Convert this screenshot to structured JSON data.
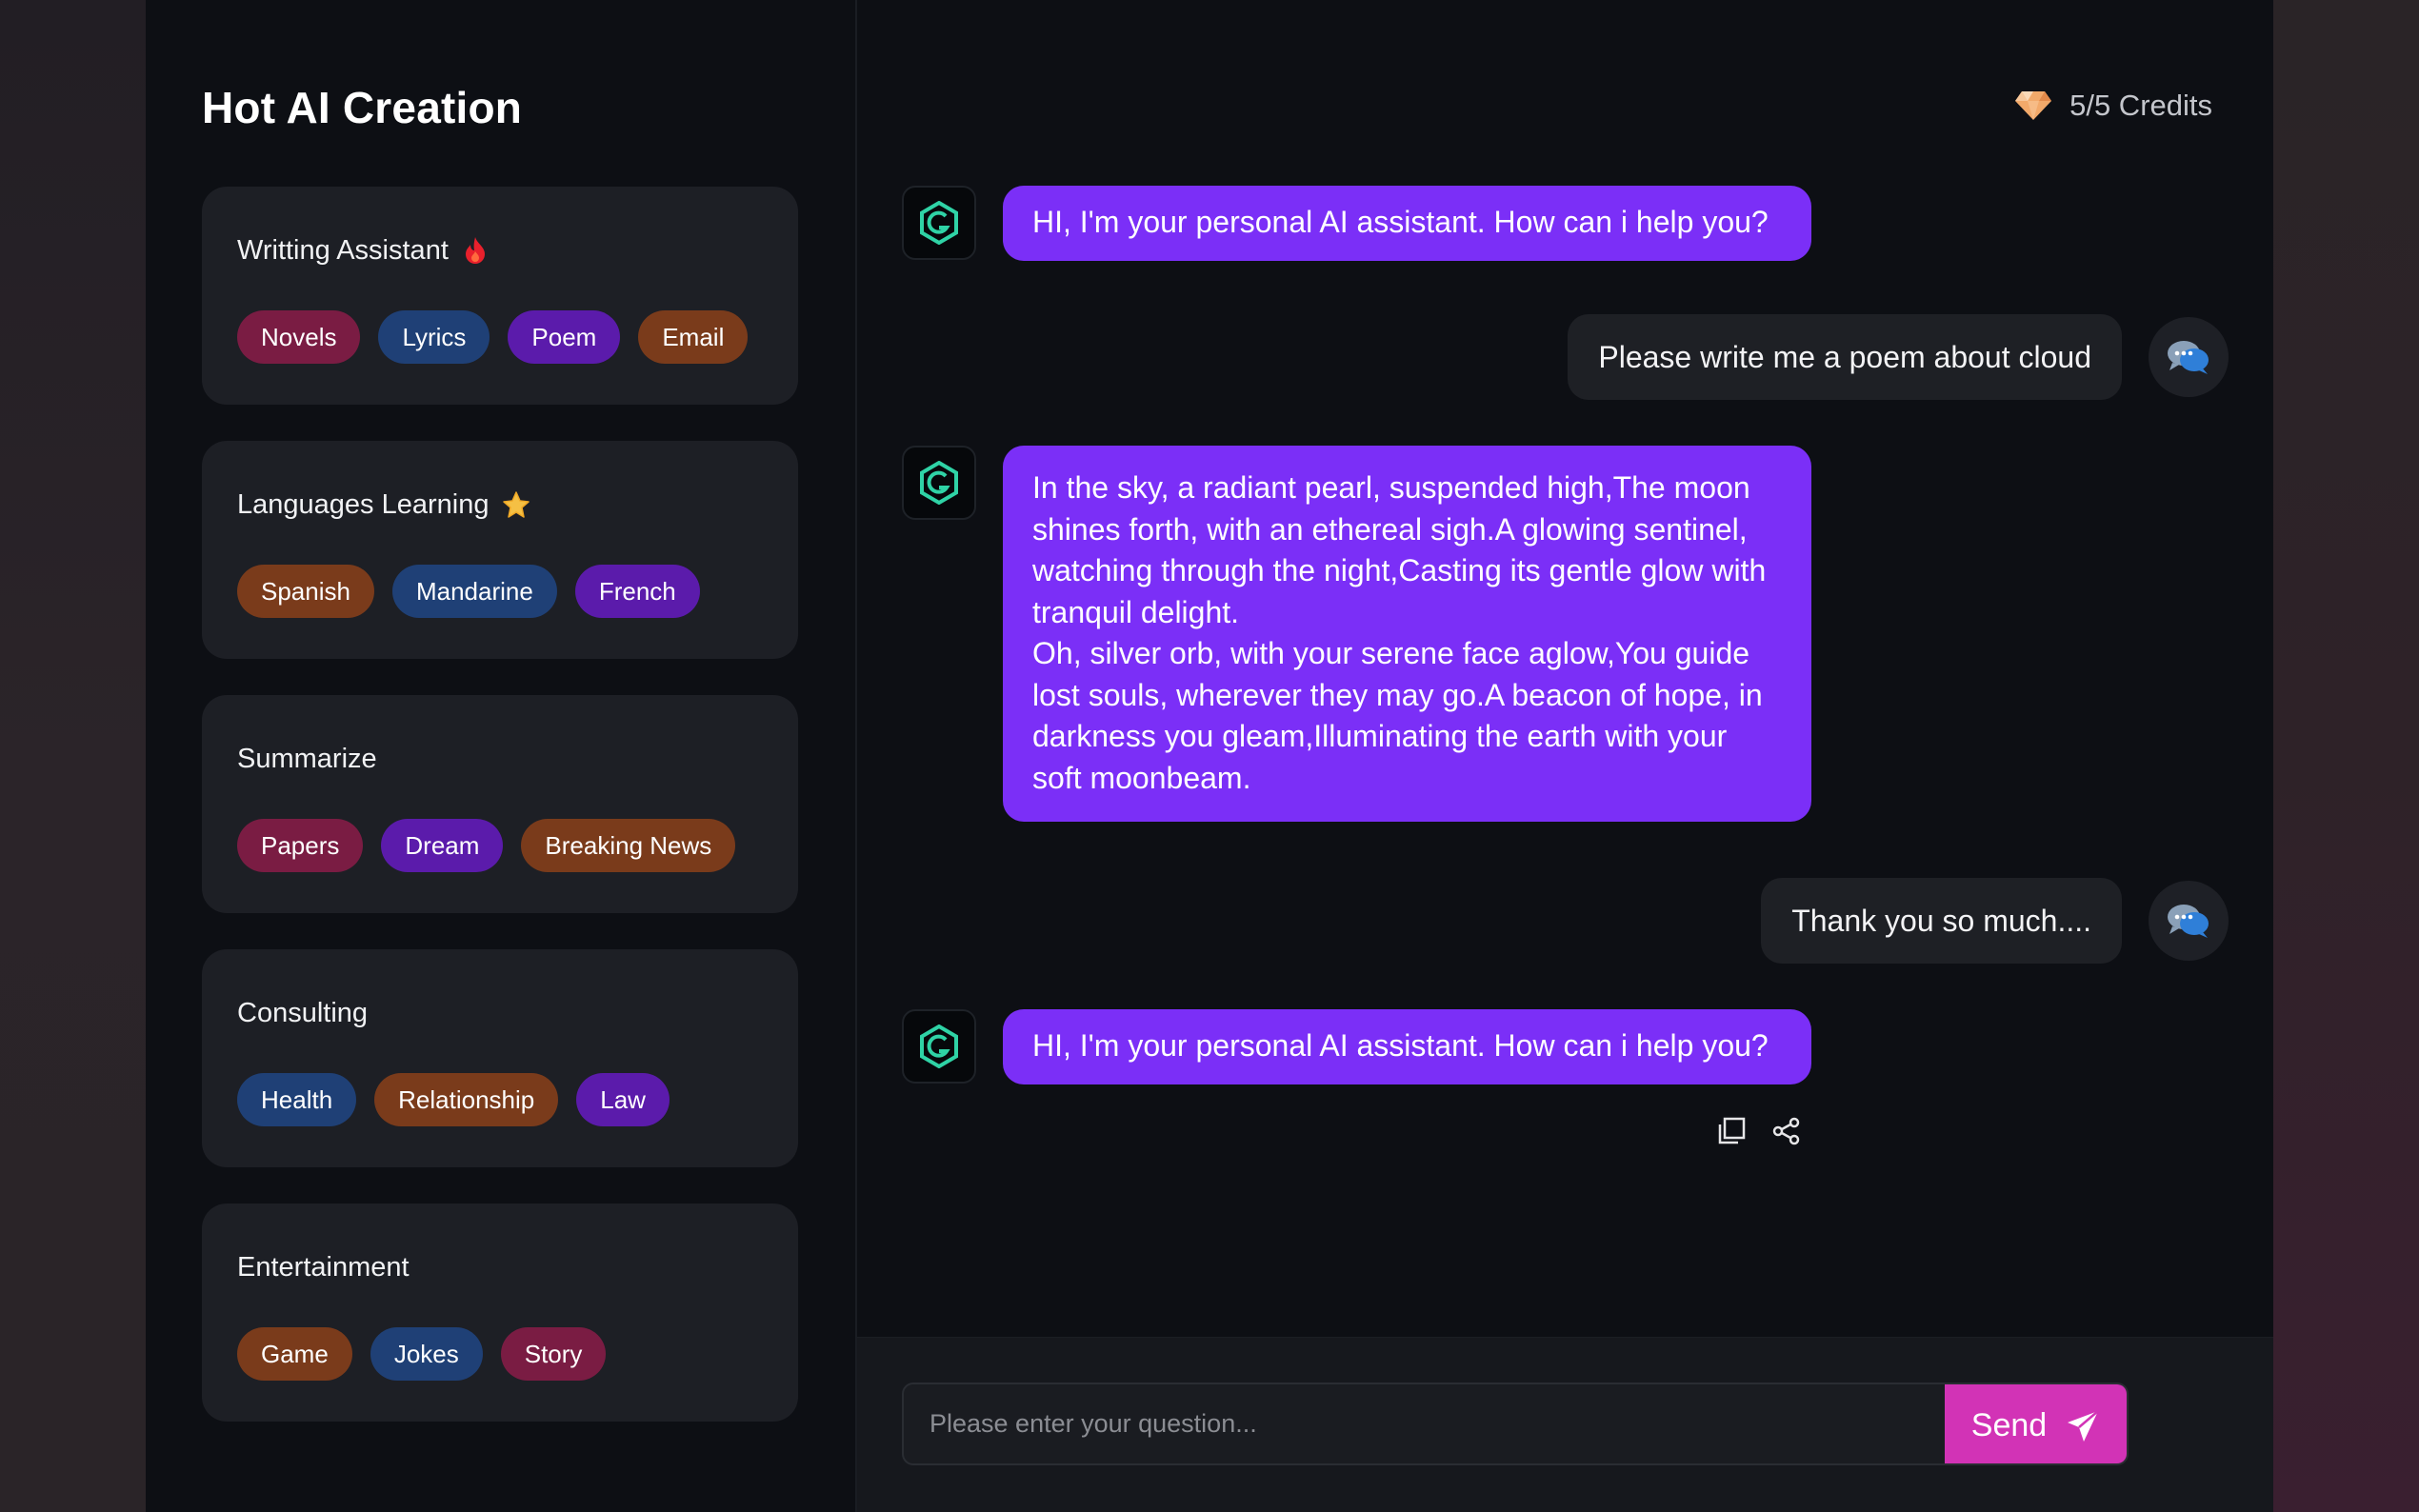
{
  "sidebar": {
    "title": "Hot AI Creation",
    "cards": [
      {
        "title": "Writting Assistant",
        "icon": "fire-icon",
        "tags": [
          {
            "label": "Novels",
            "color": "crimson"
          },
          {
            "label": "Lyrics",
            "color": "blue"
          },
          {
            "label": "Poem",
            "color": "purple"
          },
          {
            "label": "Email",
            "color": "brown"
          }
        ]
      },
      {
        "title": "Languages Learning",
        "icon": "star-icon",
        "tags": [
          {
            "label": "Spanish",
            "color": "brown"
          },
          {
            "label": "Mandarine",
            "color": "blue"
          },
          {
            "label": "French",
            "color": "purple"
          }
        ]
      },
      {
        "title": "Summarize",
        "icon": "",
        "tags": [
          {
            "label": "Papers",
            "color": "crimson"
          },
          {
            "label": "Dream",
            "color": "purple"
          },
          {
            "label": "Breaking News",
            "color": "brown"
          }
        ]
      },
      {
        "title": "Consulting",
        "icon": "",
        "tags": [
          {
            "label": "Health",
            "color": "blue"
          },
          {
            "label": "Relationship",
            "color": "brown"
          },
          {
            "label": "Law",
            "color": "purple"
          }
        ]
      },
      {
        "title": "Entertainment",
        "icon": "",
        "tags": [
          {
            "label": "Game",
            "color": "brown"
          },
          {
            "label": "Jokes",
            "color": "blue"
          },
          {
            "label": "Story",
            "color": "crimson"
          }
        ]
      }
    ]
  },
  "header": {
    "credits": "5/5 Credits"
  },
  "chat": {
    "messages": [
      {
        "role": "ai",
        "text": "HI, I'm your personal AI assistant. How can i help you?"
      },
      {
        "role": "user",
        "text": "Please write me a poem about cloud"
      },
      {
        "role": "ai",
        "text": "In the sky, a radiant pearl, suspended high,The moon shines forth, with an ethereal sigh.A glowing sentinel, watching through the night,Casting its gentle glow with tranquil delight.\nOh, silver orb, with your serene face aglow,You guide lost souls, wherever they may go.A beacon of hope, in darkness you gleam,Illuminating the earth with your soft moonbeam."
      },
      {
        "role": "user",
        "text": "Thank you so much...."
      },
      {
        "role": "ai",
        "text": "HI, I'm your personal AI assistant. How can i help you?"
      }
    ]
  },
  "input": {
    "placeholder": "Please enter your question...",
    "send_label": "Send"
  },
  "colors": {
    "accent_purple": "#7b2ff7",
    "send_button": "#d233b6",
    "bot_icon": "#2fd3a6"
  }
}
